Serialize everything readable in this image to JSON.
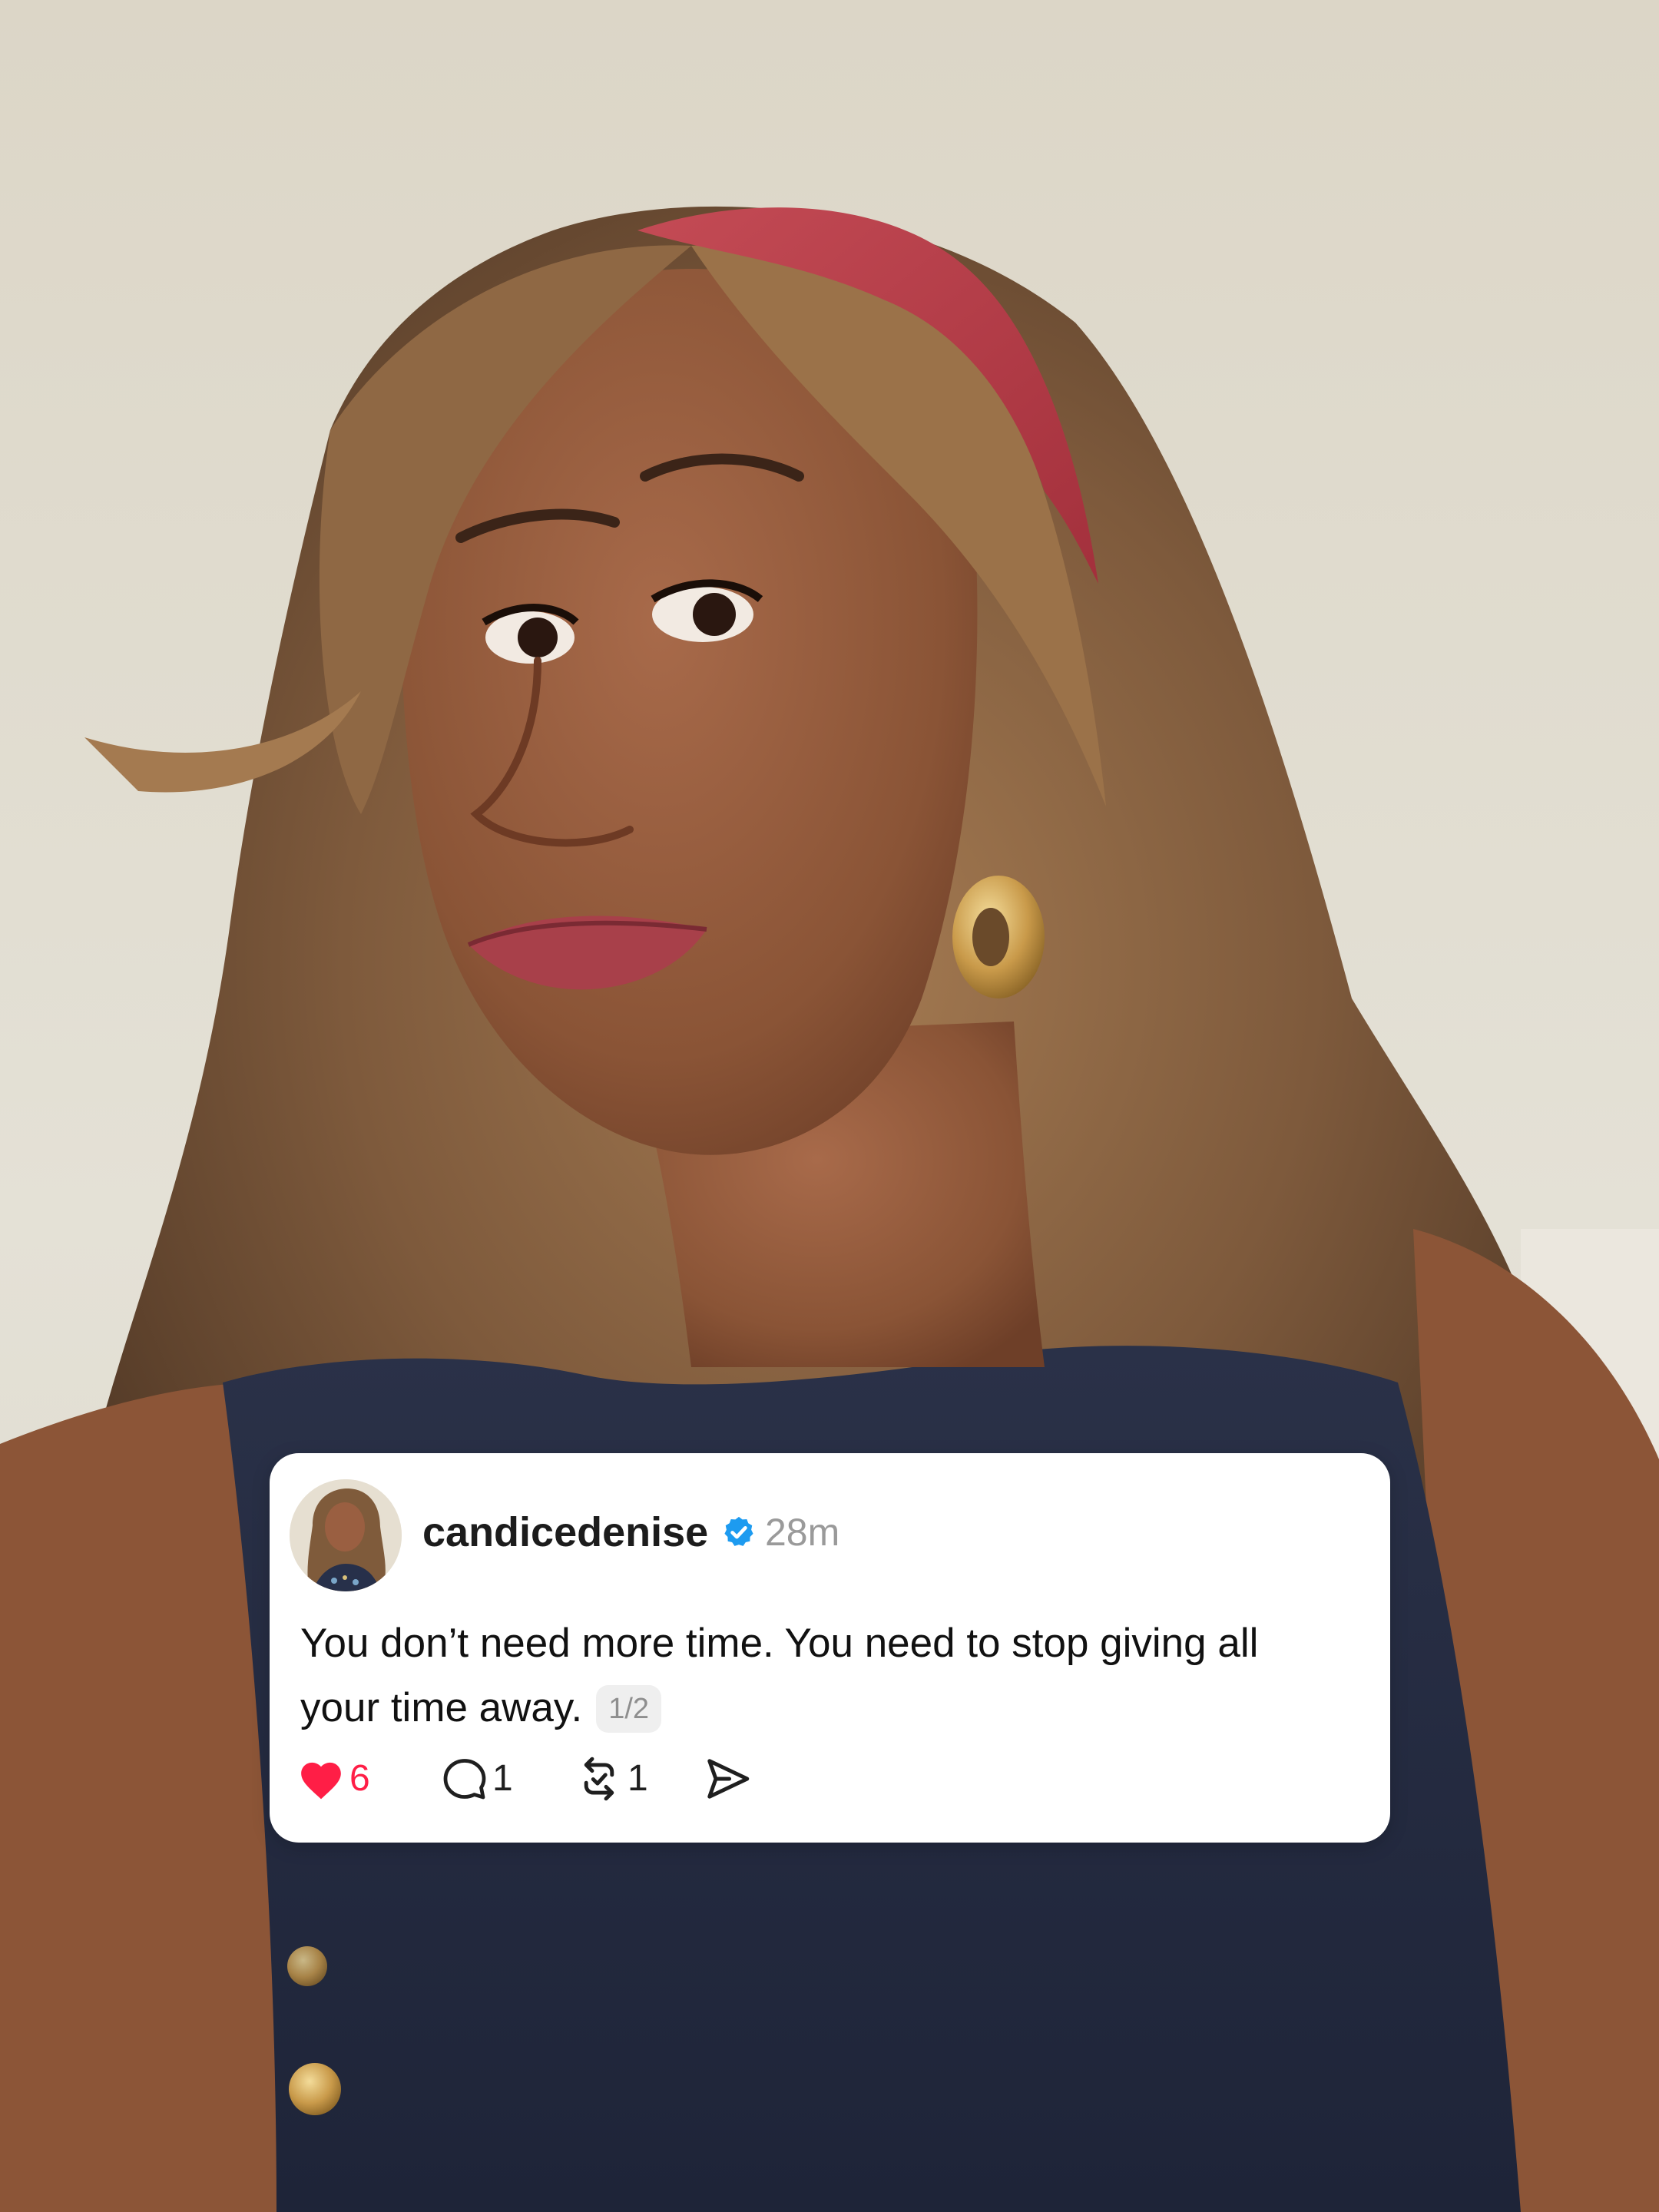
{
  "post": {
    "username": "candicedenise",
    "verified": true,
    "timestamp": "28m",
    "text_lines": [
      "You don’t need more time. You need to stop giving all",
      "your time away."
    ],
    "thread_position": "1/2",
    "likes": "6",
    "replies": "1",
    "reposts": "1",
    "liked": true
  },
  "colors": {
    "like_red": "#ff1e46",
    "verified_blue": "#1d9bf0",
    "card_background": "#ffffff",
    "timestamp_gray": "#9a9a9a"
  },
  "icons": {
    "like": "heart-filled-icon",
    "reply": "speech-bubble-icon",
    "repost": "repost-arrows-icon",
    "share": "paper-plane-icon",
    "verified": "verified-badge-icon"
  }
}
